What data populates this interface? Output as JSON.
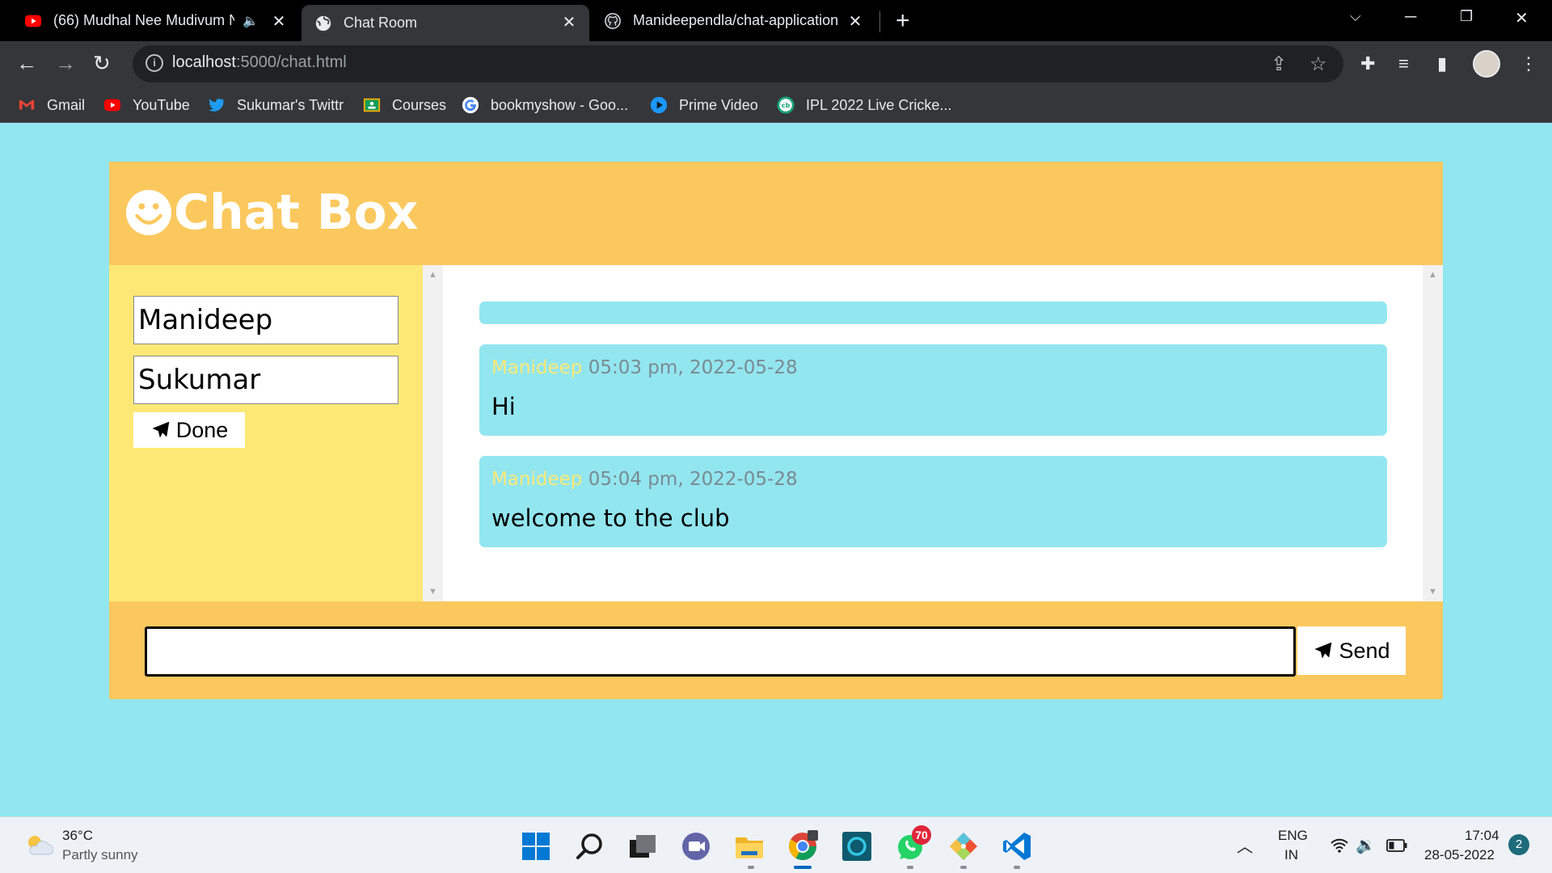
{
  "browser": {
    "tabs": [
      {
        "title": "(66) Mudhal Nee Mudivum N",
        "favicon": "youtube-icon",
        "audio": true
      },
      {
        "title": "Chat Room",
        "favicon": "globe-icon",
        "active": true
      },
      {
        "title": "Manideependla/chat-application",
        "favicon": "github-icon"
      }
    ],
    "url_host": "localhost",
    "url_rest": ":5000/chat.html",
    "bookmarks": [
      {
        "label": "Gmail",
        "icon": "gmail-icon"
      },
      {
        "label": "YouTube",
        "icon": "youtube-icon"
      },
      {
        "label": "Sukumar's Twittr",
        "icon": "twitter-icon"
      },
      {
        "label": "Courses",
        "icon": "classroom-icon"
      },
      {
        "label": "bookmyshow - Goo...",
        "icon": "google-icon"
      },
      {
        "label": "Prime Video",
        "icon": "prime-video-icon"
      },
      {
        "label": "IPL 2022 Live Cricke...",
        "icon": "cricbuzz-icon"
      }
    ]
  },
  "chat": {
    "title": "Chat Box",
    "username": "Manideep",
    "recipient": "Sukumar",
    "done_label": "Done",
    "send_label": "Send",
    "message_input": "",
    "messages": [
      {
        "sender": "Manideep",
        "time": "05:03 pm, 2022-05-28",
        "text": "Hi"
      },
      {
        "sender": "Manideep",
        "time": "05:04 pm, 2022-05-28",
        "text": "welcome to the club"
      }
    ]
  },
  "taskbar": {
    "weather_temp": "36°C",
    "weather_desc": "Partly sunny",
    "whatsapp_badge": "70",
    "lang_top": "ENG",
    "lang_bottom": "IN",
    "time": "17:04",
    "date": "28-05-2022",
    "notification_count": "2"
  },
  "colors": {
    "page_bg": "#92e6f0",
    "header": "#fbc85e",
    "sidebar": "#fde876",
    "message_bg": "#92e6f0"
  }
}
